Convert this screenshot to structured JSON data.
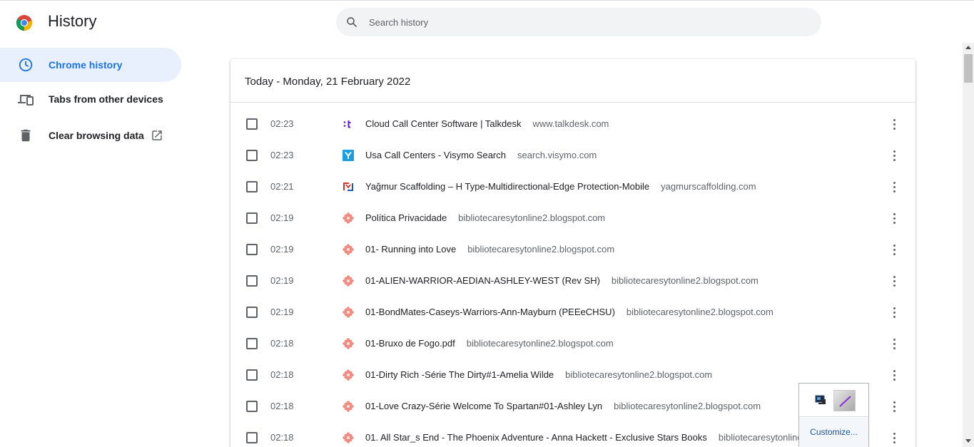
{
  "header": {
    "title": "History",
    "search_placeholder": "Search history",
    "search_value": ""
  },
  "sidebar": {
    "items": [
      {
        "label": "Chrome history",
        "icon": "clock-icon",
        "active": true
      },
      {
        "label": "Tabs from other devices",
        "icon": "devices-icon",
        "active": false
      },
      {
        "label": "Clear browsing data",
        "icon": "trash-icon",
        "active": false
      }
    ]
  },
  "card": {
    "date_header": "Today - Monday, 21 February 2022"
  },
  "history": [
    {
      "time": "02:23",
      "title": "Cloud Call Center Software | Talkdesk",
      "domain": "www.talkdesk.com",
      "icon": "talkdesk-favicon"
    },
    {
      "time": "02:23",
      "title": "Usa Call Centers - Visymo Search",
      "domain": "search.visymo.com",
      "icon": "visymo-favicon"
    },
    {
      "time": "02:21",
      "title": "Yağmur Scaffolding – H Type-Multidirectional-Edge Protection-Mobile",
      "domain": "yagmurscaffolding.com",
      "icon": "yagmur-favicon"
    },
    {
      "time": "02:19",
      "title": "Política Privacidade",
      "domain": "bibliotecaresytonline2.blogspot.com",
      "icon": "flower-favicon"
    },
    {
      "time": "02:19",
      "title": "01- Running into Love",
      "domain": "bibliotecaresytonline2.blogspot.com",
      "icon": "flower-favicon"
    },
    {
      "time": "02:19",
      "title": "01-ALIEN-WARRIOR-AEDIAN-ASHLEY-WEST (Rev SH)",
      "domain": "bibliotecaresytonline2.blogspot.com",
      "icon": "flower-favicon"
    },
    {
      "time": "02:19",
      "title": "01-BondMates-Caseys-Warriors-Ann-Mayburn (PEEeCHSU)",
      "domain": "bibliotecaresytonline2.blogspot.com",
      "icon": "flower-favicon"
    },
    {
      "time": "02:18",
      "title": "01-Bruxo de Fogo.pdf",
      "domain": "bibliotecaresytonline2.blogspot.com",
      "icon": "flower-favicon"
    },
    {
      "time": "02:18",
      "title": "01-Dirty Rich -Série The Dirty#1-Amelia Wilde",
      "domain": "bibliotecaresytonline2.blogspot.com",
      "icon": "flower-favicon"
    },
    {
      "time": "02:18",
      "title": "01-Love Crazy-Série Welcome To Spartan#01-Ashley Lyn",
      "domain": "bibliotecaresytonline2.blogspot.com",
      "icon": "flower-favicon"
    },
    {
      "time": "02:18",
      "title": "01. All Star_s End - The Phoenix Adventure - Anna Hackett - Exclusive Stars Books",
      "domain": "bibliotecaresytonline2",
      "icon": "flower-favicon"
    }
  ],
  "popup": {
    "link_label": "Customize..."
  },
  "colors": {
    "accent": "#1a73e8",
    "active_bg": "#e8f0fe",
    "search_bg": "#f1f3f4",
    "text_secondary": "#5f6368"
  }
}
